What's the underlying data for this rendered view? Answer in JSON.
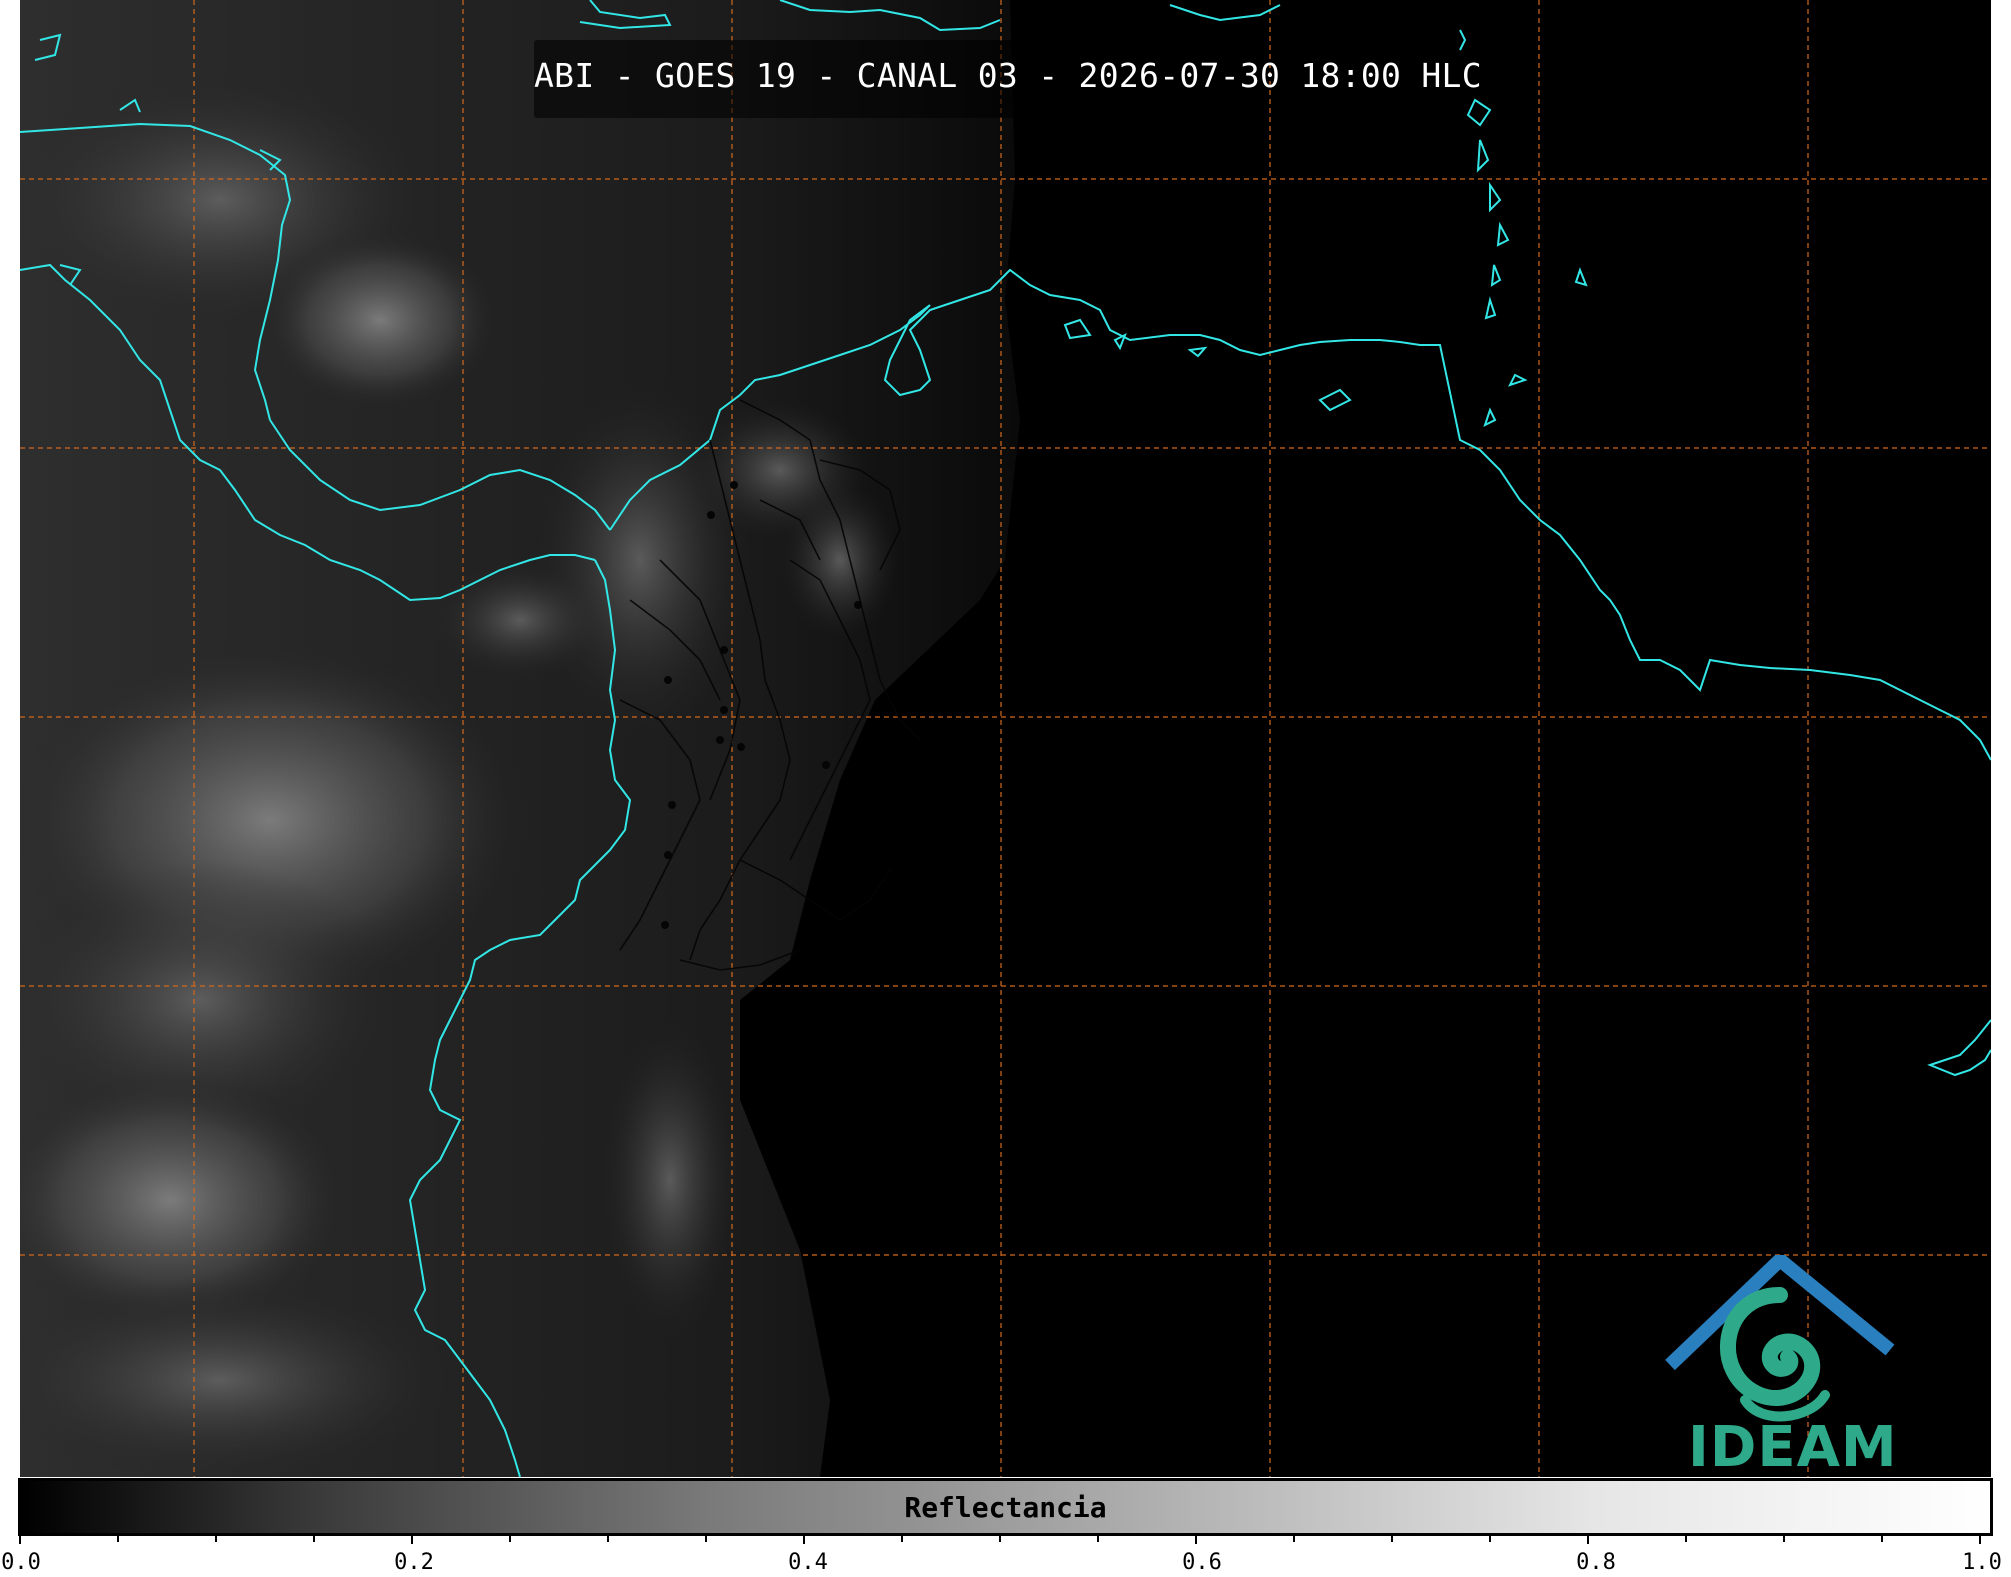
{
  "title": "ABI - GOES 19 - CANAL 03 - 2026-07-30 18:00 HLC",
  "colorbar": {
    "label": "Reflectancia",
    "ticks": [
      "0.0",
      "0.2",
      "0.4",
      "0.6",
      "0.8",
      "1.0"
    ],
    "range": [
      0.0,
      1.0
    ]
  },
  "logo": {
    "text": "IDEAM"
  },
  "colors": {
    "coastline": "#33e6e6",
    "gridlines": "#d2691e",
    "logo_teal": "#2eaa8a",
    "logo_blue": "#2a7fbf"
  }
}
